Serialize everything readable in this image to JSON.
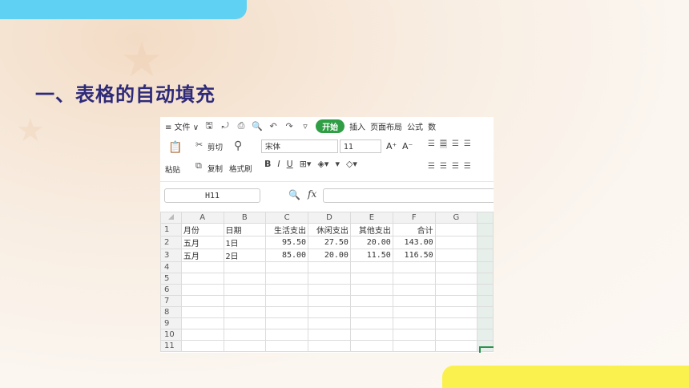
{
  "slide": {
    "title": "一、表格的自动填充"
  },
  "menubar": {
    "menu_label": "≡ 文件 ∨",
    "icons": [
      "save-icon",
      "redo-icon",
      "print-icon",
      "print-preview-icon",
      "undo-icon",
      "redo-arrow-icon",
      "more-icon"
    ],
    "icon_glyphs": [
      "🖫",
      "⤾",
      "⎙",
      "🔍",
      "↶",
      "↷",
      "▿"
    ],
    "tabs": [
      "开始",
      "插入",
      "页面布局",
      "公式",
      "数"
    ]
  },
  "ribbon": {
    "paste": "粘贴",
    "cut": "剪切",
    "copy": "复制",
    "format_painter": "格式刷",
    "font_name": "宋体",
    "font_size": "11",
    "grow": "A⁺",
    "shrink": "A⁻",
    "bold": "B",
    "italic": "I",
    "underline": "U"
  },
  "formula_bar": {
    "name_box": "H11",
    "fx": "fx"
  },
  "sheet": {
    "columns": [
      "A",
      "B",
      "C",
      "D",
      "E",
      "F",
      "G"
    ],
    "rows": [
      {
        "n": "1",
        "cells": [
          "月份",
          "日期",
          "生活支出",
          "休闲支出",
          "其他支出",
          "合计",
          ""
        ]
      },
      {
        "n": "2",
        "cells": [
          "五月",
          "1日",
          "95.50",
          "27.50",
          "20.00",
          "143.00",
          ""
        ]
      },
      {
        "n": "3",
        "cells": [
          "五月",
          "2日",
          "85.00",
          "20.00",
          "11.50",
          "116.50",
          ""
        ]
      },
      {
        "n": "4",
        "cells": [
          "",
          "",
          "",
          "",
          "",
          "",
          ""
        ]
      },
      {
        "n": "5",
        "cells": [
          "",
          "",
          "",
          "",
          "",
          "",
          ""
        ]
      },
      {
        "n": "6",
        "cells": [
          "",
          "",
          "",
          "",
          "",
          "",
          ""
        ]
      },
      {
        "n": "7",
        "cells": [
          "",
          "",
          "",
          "",
          "",
          "",
          ""
        ]
      },
      {
        "n": "8",
        "cells": [
          "",
          "",
          "",
          "",
          "",
          "",
          ""
        ]
      },
      {
        "n": "9",
        "cells": [
          "",
          "",
          "",
          "",
          "",
          "",
          ""
        ]
      },
      {
        "n": "10",
        "cells": [
          "",
          "",
          "",
          "",
          "",
          "",
          ""
        ]
      },
      {
        "n": "11",
        "cells": [
          "",
          "",
          "",
          "",
          "",
          "",
          ""
        ]
      }
    ]
  },
  "colors": {
    "top_tab": "#5fd2f3",
    "bottom_bar": "#fbf14e",
    "title": "#2e2a7a",
    "start_tab": "#2f9e44"
  }
}
